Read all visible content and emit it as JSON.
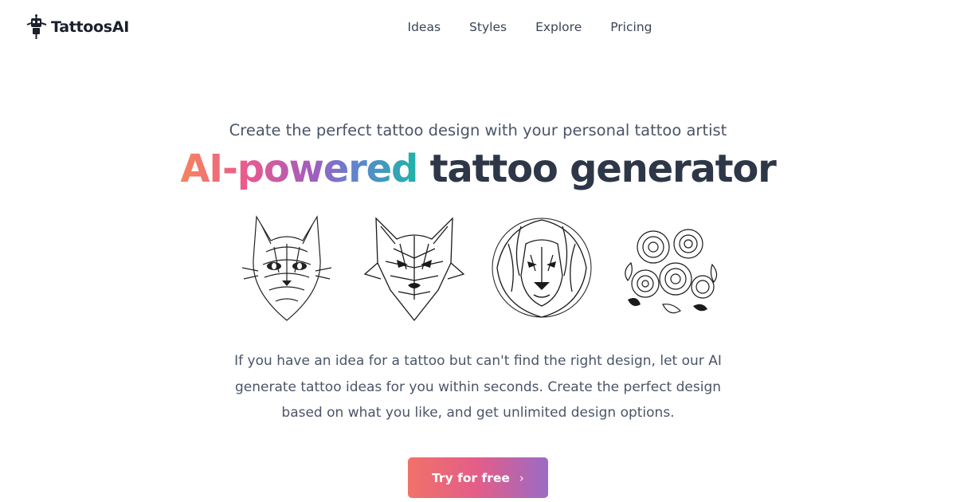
{
  "brand": {
    "name": "TattoosAI",
    "logo_icon": "robot-tattoo-machine-icon"
  },
  "nav": {
    "items": [
      "Ideas",
      "Styles",
      "Explore",
      "Pricing"
    ]
  },
  "hero": {
    "subtitle": "Create the perfect tattoo design with your personal tattoo artist",
    "headline_gradient": "AI-powered",
    "headline_rest": "tattoo generator",
    "gradient_colors": [
      "#f6855c",
      "#ea5a8e",
      "#a45cbd",
      "#5c86cf",
      "#1fb3a8"
    ]
  },
  "gallery": [
    {
      "icon": "cat-tattoo-image"
    },
    {
      "icon": "wolf-tattoo-image"
    },
    {
      "icon": "lion-tattoo-image"
    },
    {
      "icon": "roses-tattoo-image"
    }
  ],
  "description": "If you have an idea for a tattoo but can't find the right design, let our AI generate tattoo ideas for you within seconds. Create the perfect design based on what you like, and get unlimited design options.",
  "cta": {
    "label": "Try for free",
    "icon": "chevron-right-icon"
  }
}
